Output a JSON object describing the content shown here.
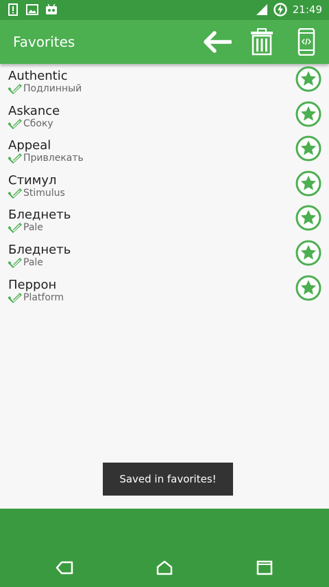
{
  "status_bar": {
    "time": "21:49",
    "icons_left": [
      "alert-icon",
      "image-icon",
      "android-icon"
    ],
    "icons_right": [
      "signal-icon",
      "battery-charging-icon"
    ]
  },
  "app_bar": {
    "title": "Favorites",
    "actions": [
      "back-arrow-icon",
      "trash-icon",
      "phone-code-icon"
    ]
  },
  "favorites": [
    {
      "word": "Authentic",
      "translation": "Подлинный"
    },
    {
      "word": "Askance",
      "translation": "Сбоку"
    },
    {
      "word": "Appeal",
      "translation": "Привлекать"
    },
    {
      "word": "Стимул",
      "translation": "Stimulus"
    },
    {
      "word": "Бледнеть",
      "translation": "Pale"
    },
    {
      "word": "Бледнеть",
      "translation": "Pale"
    },
    {
      "word": "Перрон",
      "translation": "Platform"
    }
  ],
  "toast": {
    "text": "Saved in favorites!"
  },
  "nav_bar": {
    "buttons": [
      "back-icon",
      "home-icon",
      "recents-icon"
    ]
  },
  "colors": {
    "primary": "#4caf50",
    "primary_dark": "#3a9a3f",
    "toast_bg": "#333333",
    "list_bg": "#f7f7f7"
  }
}
